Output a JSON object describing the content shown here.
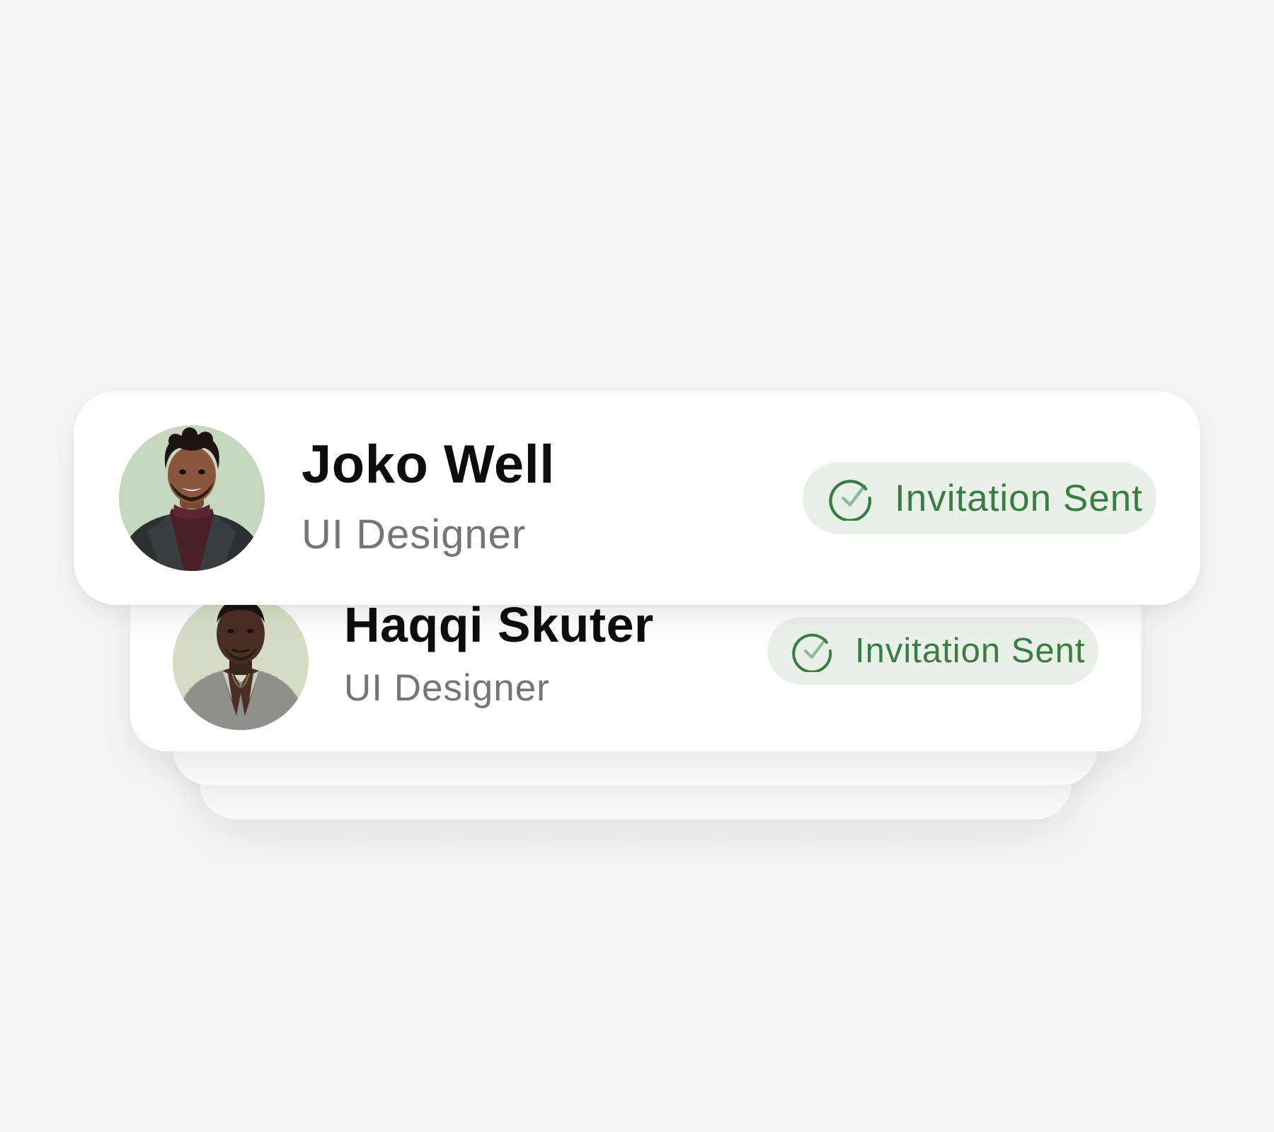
{
  "colors": {
    "background": "#f5f5f5",
    "card": "#ffffff",
    "name_text": "#0d0d0d",
    "role_text": "#757575",
    "pill_background": "#e8f0e8",
    "pill_accent": "#3a7d44"
  },
  "invites": [
    {
      "name": "Joko Well",
      "role": "UI Designer",
      "status": "Invitation Sent",
      "status_icon": "check-circle-icon",
      "avatar_background": "#c5d7bf"
    },
    {
      "name": "Haqqi Skuter",
      "role": "UI Designer",
      "status": "Invitation Sent",
      "status_icon": "check-circle-icon",
      "avatar_background": "#d5dcc3"
    }
  ]
}
